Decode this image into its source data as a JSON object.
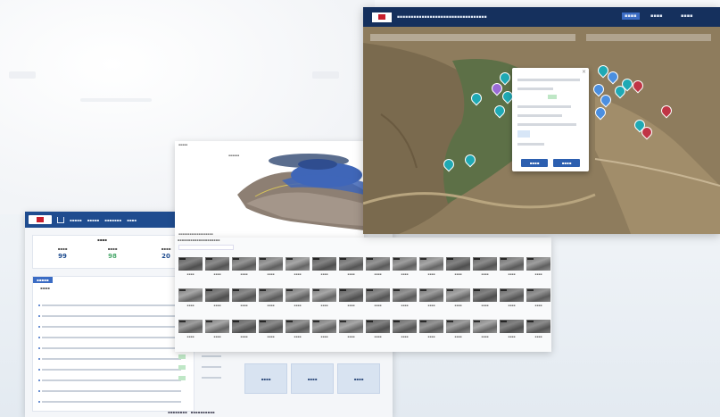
{
  "dashboard": {
    "stats": [
      {
        "value": "99",
        "color": "#1f4c8f"
      },
      {
        "value": "98",
        "color": "#4aa96c"
      },
      {
        "value": "20",
        "color": "#1f4c8f"
      }
    ]
  },
  "colors": {
    "map_header": "#15305d",
    "dashboard_header": "#1f4c8f",
    "accent_blue": "#3b6cc4",
    "marker_teal": "#1fa9b4",
    "marker_red": "#c03545",
    "marker_blue": "#4b8fe0"
  },
  "icons": [
    "brand-logo-icon",
    "home-icon",
    "map-marker-icon",
    "close-icon"
  ]
}
